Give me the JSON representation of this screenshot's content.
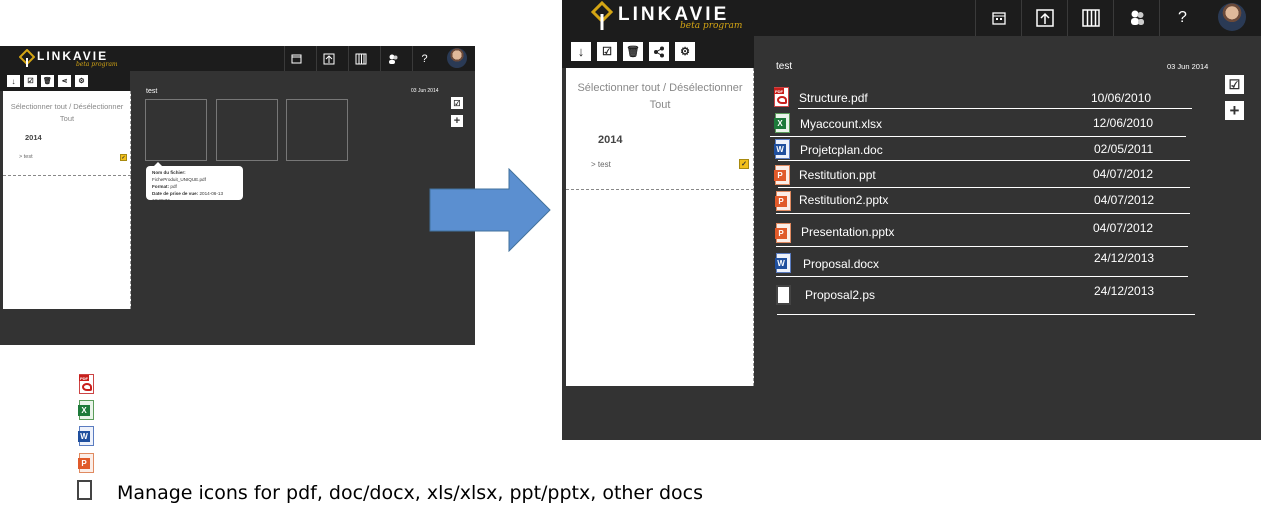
{
  "app": {
    "logo_text": "LINKAVIE",
    "logo_sub": "beta program",
    "help_label": "?"
  },
  "sidepanel": {
    "select_toggle": "Sélectionner tout / Désélectionner Tout",
    "year": "2014",
    "folder": "> test"
  },
  "content": {
    "title": "test",
    "date": "03 Jun 2014",
    "add_label": "+",
    "check_label": "☑"
  },
  "tooltip": {
    "filename_label": "Nom du fichier:",
    "filename_value": "FicheProduit_UNIQUE.pdf",
    "format_label": "Format:",
    "format_value": "pdf",
    "date_label": "Date de prise de vue:",
    "date_value": "2014-06-13 18:28:36"
  },
  "files": [
    {
      "name": "Structure.pdf",
      "date": "10/06/2010",
      "type": "pdf"
    },
    {
      "name": "Myaccount.xlsx",
      "date": "12/06/2010",
      "type": "xls"
    },
    {
      "name": "Projetcplan.doc",
      "date": "02/05/2011",
      "type": "doc"
    },
    {
      "name": "Restitution.ppt",
      "date": "04/07/2012",
      "type": "ppt"
    },
    {
      "name": "Restitution2.pptx",
      "date": "04/07/2012",
      "type": "ppt"
    },
    {
      "name": "Presentation.pptx",
      "date": "04/07/2012",
      "type": "ppt"
    },
    {
      "name": "Proposal.docx",
      "date": "24/12/2013",
      "type": "doc"
    },
    {
      "name": "Proposal2.ps",
      "date": "24/12/2013",
      "type": "other"
    }
  ],
  "legend": {
    "text": "Manage icons for pdf, doc/docx, xls/xlsx, ppt/pptx, other docs"
  },
  "colors": {
    "app_bg": "#333333",
    "topbar": "#1c1c1c",
    "accent": "#d4a514",
    "arrow": "#5b8fd0"
  }
}
